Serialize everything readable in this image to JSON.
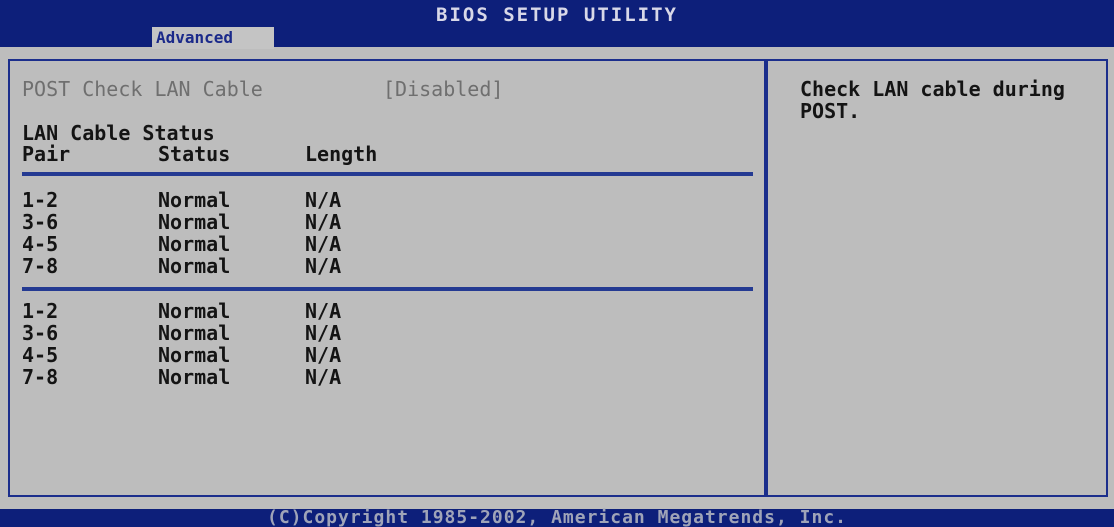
{
  "header": {
    "title": "BIOS SETUP UTILITY",
    "active_tab": "Advanced"
  },
  "setting": {
    "label": "POST Check LAN Cable",
    "value": "[Disabled]"
  },
  "lan_status": {
    "title": "LAN Cable Status",
    "columns": [
      "Pair",
      "Status",
      "Length"
    ],
    "groups": [
      [
        {
          "pair": "1-2",
          "status": "Normal",
          "length": "N/A"
        },
        {
          "pair": "3-6",
          "status": "Normal",
          "length": "N/A"
        },
        {
          "pair": "4-5",
          "status": "Normal",
          "length": "N/A"
        },
        {
          "pair": "7-8",
          "status": "Normal",
          "length": "N/A"
        }
      ],
      [
        {
          "pair": "1-2",
          "status": "Normal",
          "length": "N/A"
        },
        {
          "pair": "3-6",
          "status": "Normal",
          "length": "N/A"
        },
        {
          "pair": "4-5",
          "status": "Normal",
          "length": "N/A"
        },
        {
          "pair": "7-8",
          "status": "Normal",
          "length": "N/A"
        }
      ]
    ]
  },
  "help": {
    "text": "Check LAN cable during POST."
  },
  "footer": {
    "copyright": "(C)Copyright 1985-2002, American Megatrends, Inc."
  },
  "colors": {
    "header_bg": "#0d1f7a",
    "panel_bg": "#bdbdbd",
    "border": "#1b2e8c",
    "text": "#141414",
    "dim_text": "#6f6f6f"
  }
}
